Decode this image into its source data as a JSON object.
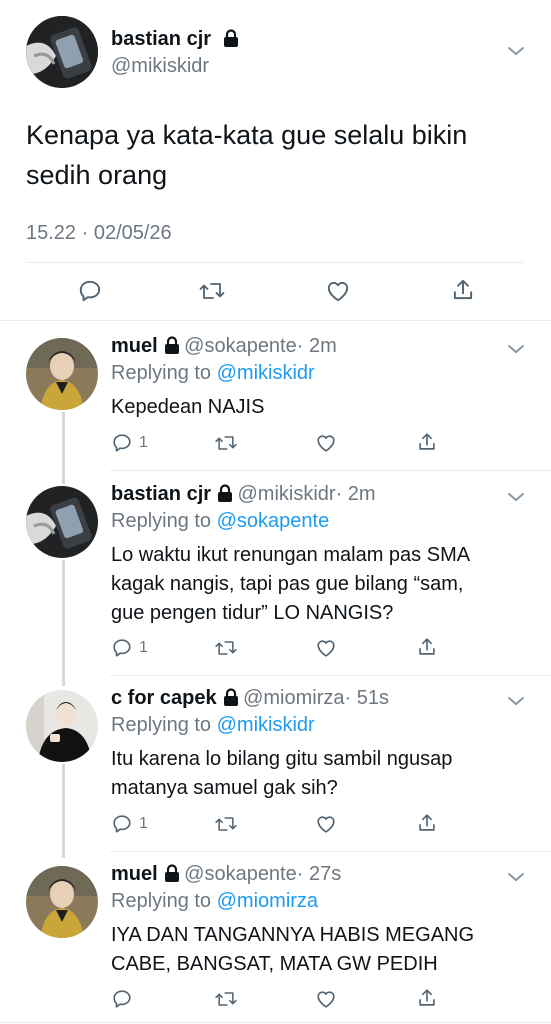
{
  "main_tweet": {
    "name": "bastian cjr",
    "handle": "@mikiskidr",
    "text_line1": "Kenapa ya kata-kata gue selalu bikin",
    "text_line2": "sedih orang",
    "meta": "15.22 · 02/05/26"
  },
  "replies": [
    {
      "name": "muel",
      "handle": "@sokapente",
      "time": "· 2m",
      "replying_prefix": "Replying to",
      "replying_to": "@mikiskidr",
      "lines": [
        "Kepedean NAJIS"
      ],
      "reply_count": "1"
    },
    {
      "name": "bastian cjr",
      "handle": "@mikiskidr",
      "time": "· 2m",
      "replying_prefix": "Replying to",
      "replying_to": "@sokapente",
      "lines": [
        "Lo waktu ikut renungan malam pas SMA",
        "kagak nangis, tapi pas gue bilang “sam,",
        "gue pengen tidur” LO NANGIS?"
      ],
      "reply_count": "1"
    },
    {
      "name": "c for capek",
      "handle": "@miomirza",
      "time": "· 51s",
      "replying_prefix": "Replying to",
      "replying_to": "@mikiskidr",
      "lines": [
        "Itu karena lo bilang gitu sambil ngusap",
        "matanya samuel gak sih?"
      ],
      "reply_count": "1"
    },
    {
      "name": "muel",
      "handle": "@sokapente",
      "time": "· 27s",
      "replying_prefix": "Replying to",
      "replying_to": "@miomirza",
      "lines": [
        "IYA DAN TANGANNYA HABIS MEGANG",
        "CABE, BANGSAT, MATA GW PEDIH"
      ],
      "reply_count": ""
    }
  ],
  "icons": {
    "reply": "reply-icon",
    "retweet": "retweet-icon",
    "like": "heart-icon",
    "share": "share-icon",
    "lock": "lock-icon",
    "more": "chevron-down-icon"
  },
  "colors": {
    "link": "#1d9bf0",
    "secondary": "#6e7780",
    "thread_line": "#cfd9de"
  }
}
